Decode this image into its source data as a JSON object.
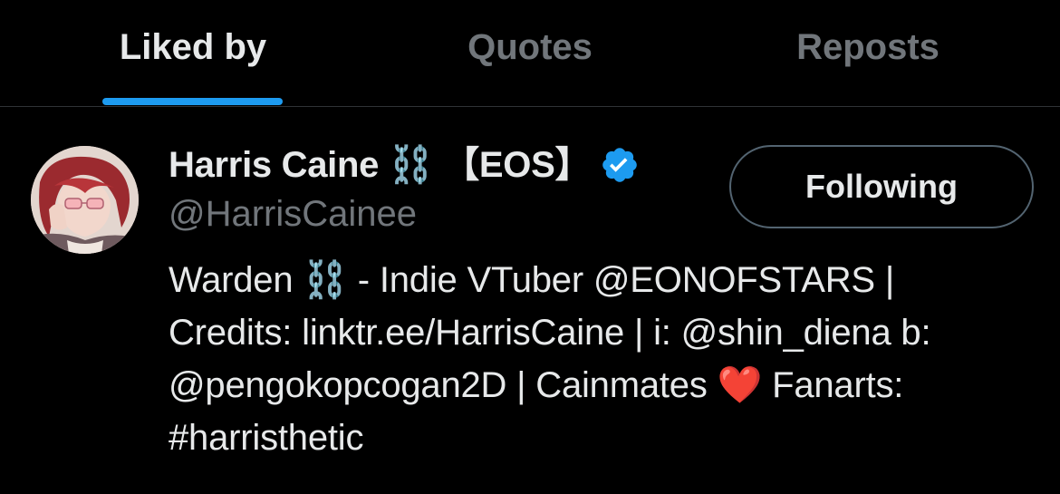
{
  "tabs": [
    {
      "label": "Liked by",
      "active": true
    },
    {
      "label": "Quotes",
      "active": false
    },
    {
      "label": "Reposts",
      "active": false
    }
  ],
  "colors": {
    "background": "#000000",
    "primary_text": "#e7e9ea",
    "secondary_text": "#71767b",
    "accent": "#1d9bf0",
    "divider": "#2f3336",
    "heart": "#e0245e"
  },
  "user": {
    "display_name": "Harris Caine ⛓️ 【EOS】",
    "handle": "@HarrisCainee",
    "verified_icon": "verified-badge-icon",
    "follow_button_label": "Following",
    "avatar_icon": "avatar",
    "bio_lines": [
      "Warden ⛓️ - Indie VTuber @EONOFSTARS |",
      "Credits: linktr.ee/HarrisCaine | i: @shin_diena b:",
      "@pengokopcogan2D | Cainmates ❤️ Fanarts:",
      "#harristhetic"
    ]
  }
}
